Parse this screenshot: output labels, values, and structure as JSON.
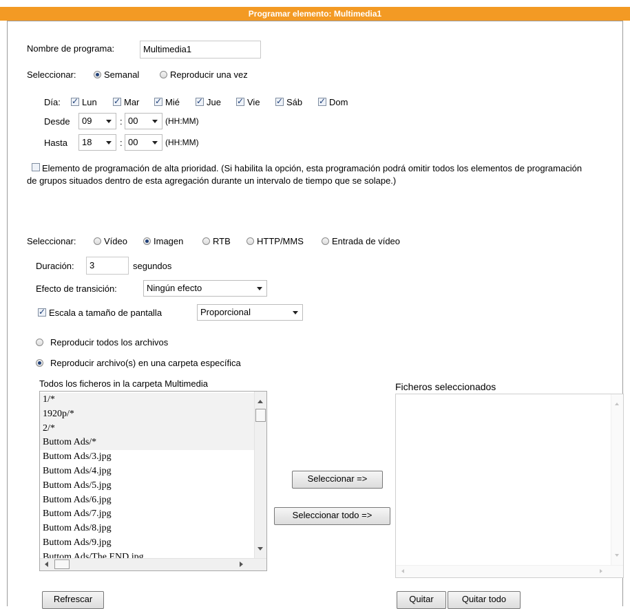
{
  "dialog": {
    "title": "Programar elemento: Multimedia1"
  },
  "schedule": {
    "name_label": "Nombre de programa:",
    "name_value": "Multimedia1",
    "select_label": "Seleccionar:",
    "mode_options": [
      {
        "label": "Semanal",
        "selected": true
      },
      {
        "label": "Reproducir una vez",
        "selected": false
      }
    ],
    "day_label": "Día:",
    "days": [
      {
        "label": "Lun",
        "checked": true
      },
      {
        "label": "Mar",
        "checked": true
      },
      {
        "label": "Mié",
        "checked": true
      },
      {
        "label": "Jue",
        "checked": true
      },
      {
        "label": "Vie",
        "checked": true
      },
      {
        "label": "Sáb",
        "checked": true
      },
      {
        "label": "Dom",
        "checked": true
      }
    ],
    "from_label": "Desde",
    "from_hour": "09",
    "from_minute": "00",
    "to_label": "Hasta",
    "to_hour": "18",
    "to_minute": "00",
    "time_colon": ":",
    "time_format": "(HH:MM)",
    "priority_checked": false,
    "priority_text": "Elemento de programación de alta prioridad. (Si habilita la opción, esta programación podrá omitir todos los elementos de programación de grupos situados dentro de esta agregación durante un intervalo de tiempo que se solape.)"
  },
  "media": {
    "select_label": "Seleccionar:",
    "type_options": [
      {
        "label": "Vídeo",
        "selected": false
      },
      {
        "label": "Imagen",
        "selected": true
      },
      {
        "label": "RTB",
        "selected": false
      },
      {
        "label": "HTTP/MMS",
        "selected": false
      },
      {
        "label": "Entrada de vídeo",
        "selected": false
      }
    ],
    "duration_label": "Duración:",
    "duration_value": "3",
    "duration_unit": "segundos",
    "transition_label": "Efecto de transición:",
    "transition_value": "Ningún efecto",
    "scale_checked": true,
    "scale_label": "Escala a tamaño de pantalla",
    "scale_value": "Proporcional",
    "play_options": [
      {
        "label": "Reproducir todos los archivos",
        "selected": false
      },
      {
        "label": "Reproducir archivo(s) en una carpeta específica",
        "selected": true
      }
    ]
  },
  "files": {
    "all_label": "Todos los ficheros in la carpeta Multimedia",
    "all_files": [
      "1/*",
      "1920p/*",
      "2/*",
      "Buttom Ads/*",
      "Buttom Ads/3.jpg",
      "Buttom Ads/4.jpg",
      "Buttom Ads/5.jpg",
      "Buttom Ads/6.jpg",
      "Buttom Ads/7.jpg",
      "Buttom Ads/8.jpg",
      "Buttom Ads/9.jpg",
      "Buttom Ads/The END.jpg"
    ],
    "selected_label": "Ficheros seleccionados",
    "selected_files": [],
    "select_button": "Seleccionar =>",
    "select_all_button": "Seleccionar todo =>",
    "refresh_button": "Refrescar",
    "remove_button": "Quitar",
    "remove_all_button": "Quitar todo"
  },
  "icons": {
    "scroll_up": "triangle-up-icon",
    "scroll_down": "triangle-down-icon",
    "scroll_left": "triangle-left-icon",
    "scroll_right": "triangle-right-icon",
    "dropdown": "chevron-down-icon"
  },
  "colors": {
    "title_bar": "#f39a24",
    "title_text": "#ffffff",
    "radio_dot": "#1e3f78"
  }
}
